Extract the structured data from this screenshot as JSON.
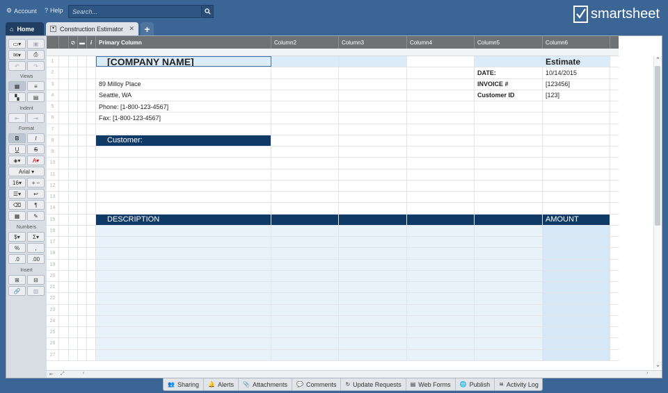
{
  "topbar": {
    "account_label": "Account",
    "help_label": "Help",
    "search_placeholder": "Search...",
    "brand": "smartsheet"
  },
  "tabs": {
    "home": "Home",
    "sheet": "Construction Estimator",
    "add": "+"
  },
  "toolbar": {
    "views_label": "Views",
    "indent_label": "Indent",
    "format_label": "Format",
    "font_name": "Arial",
    "font_size": "16",
    "numbers_label": "Numbers",
    "insert_label": "Insert"
  },
  "columns": [
    "Primary Column",
    "Column2",
    "Column3",
    "Column4",
    "Column5",
    "Column6"
  ],
  "sheet": {
    "company_name": "[COMPANY NAME]",
    "estimate_title": "Estimate",
    "address1": "89 Milloy Place",
    "address2": "Seattle, WA",
    "phone": "Phone: [1-800-123-4567]",
    "fax": "Fax: [1-800-123-4567]",
    "date_label": "DATE:",
    "date_value": "10/14/2015",
    "invoice_label": "INVOICE #",
    "invoice_value": "[123456]",
    "customer_id_label": "Customer ID",
    "customer_id_value": "[123]",
    "customer_label": "Customer:",
    "description_label": "DESCRIPTION",
    "amount_label": "AMOUNT"
  },
  "row_numbers": [
    "1",
    "2",
    "3",
    "4",
    "5",
    "6",
    "7",
    "8",
    "9",
    "10",
    "11",
    "12",
    "13",
    "14",
    "15",
    "16",
    "17",
    "18",
    "19",
    "20",
    "21",
    "22",
    "23",
    "24",
    "25",
    "26",
    "27"
  ],
  "bottom_bar": [
    "Sharing",
    "Alerts",
    "Attachments",
    "Comments",
    "Update Requests",
    "Web Forms",
    "Publish",
    "Activity Log"
  ],
  "colors": {
    "app_background": "#3b6594",
    "header_band": "#0f3a65",
    "highlight": "#dcebf8",
    "column_header": "#6f7275"
  }
}
